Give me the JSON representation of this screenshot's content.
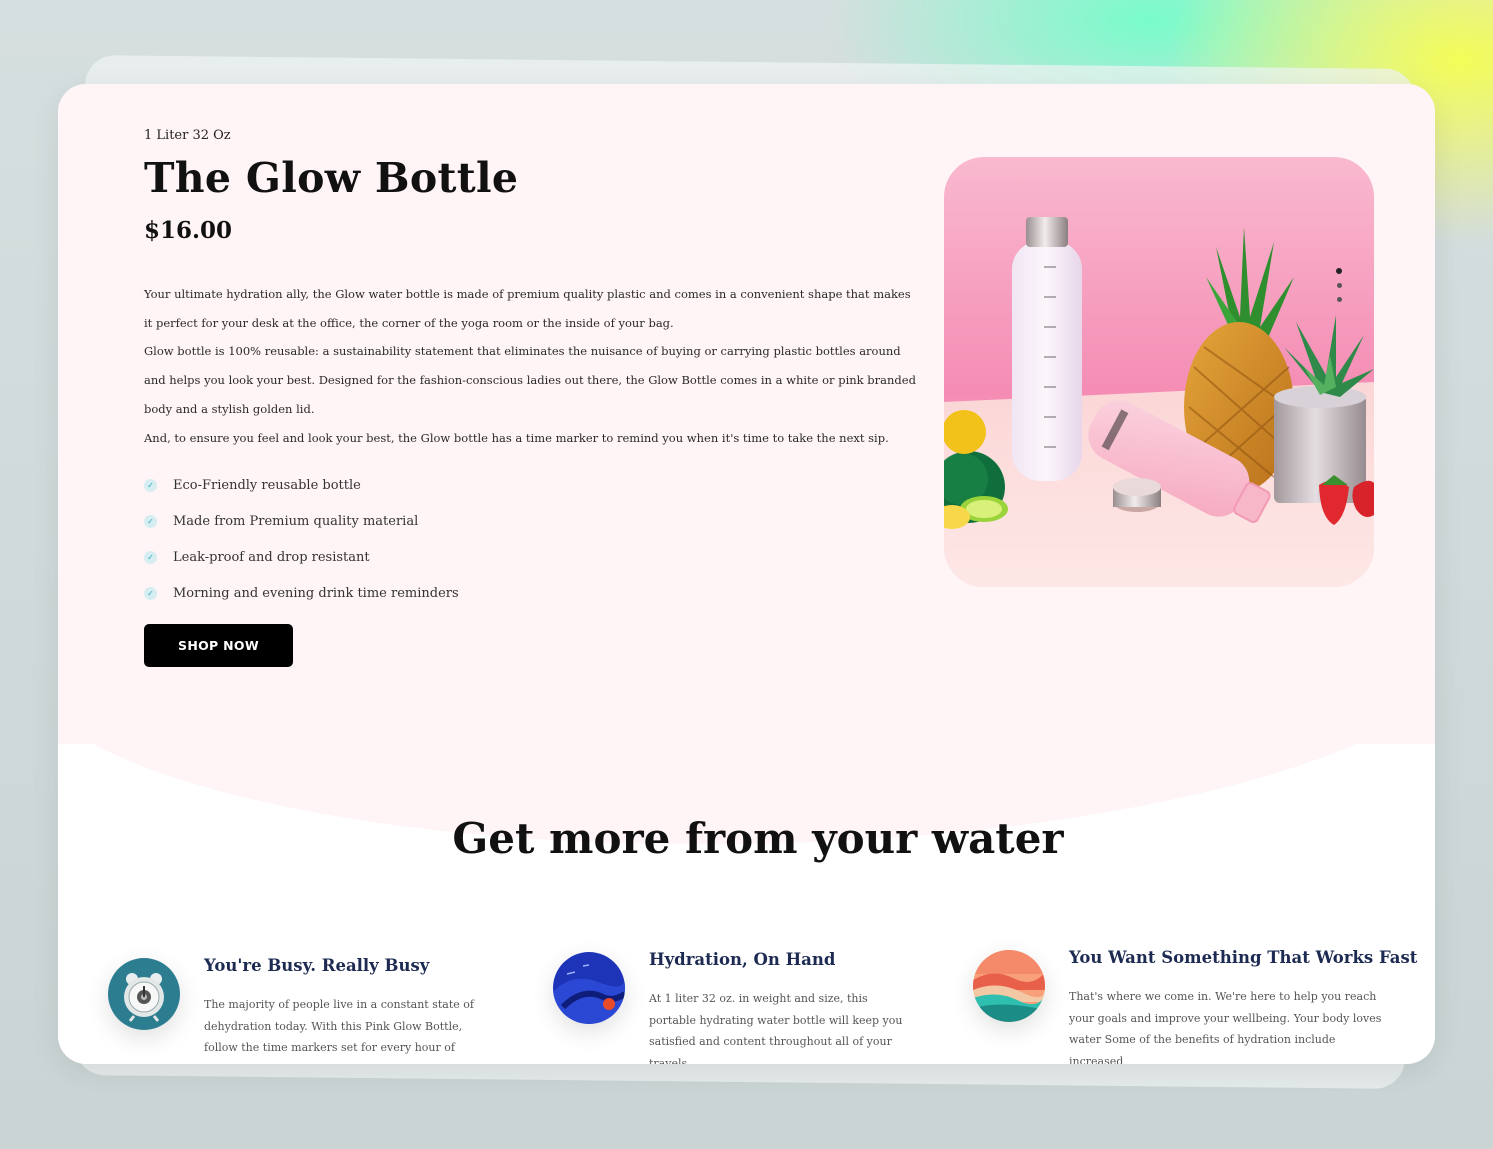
{
  "product": {
    "subtitle": "1 Liter 32 Oz",
    "title": "The Glow Bottle",
    "price": "$16.00",
    "description": [
      "Your ultimate hydration ally, the Glow water bottle is made of premium quality plastic and comes in a convenient shape that makes it perfect for your desk at the office, the corner of the yoga room or the inside of your bag.",
      "Glow bottle is 100% reusable: a sustainability statement that eliminates the nuisance of buying or carrying plastic bottles around and helps you look your best. Designed for the fashion-conscious ladies out there, the Glow Bottle comes in a white or pink branded body and a stylish golden lid.",
      "And, to ensure you feel and look your best, the Glow bottle has a time marker to remind you when it's time to take the next sip."
    ],
    "features": [
      "Eco-Friendly reusable bottle",
      "Made from Premium quality material",
      "Leak-proof and drop resistant",
      "Morning and evening drink time reminders"
    ],
    "cta_label": "SHOP NOW",
    "photo_icon": "product-photo-bottle-pineapple",
    "check_icon": "check-icon"
  },
  "section": {
    "title": "Get more from your water",
    "cards": [
      {
        "icon": "alarm-clock-icon",
        "heading": "You're Busy. Really Busy",
        "text": "The majority of people live in a constant state of dehydration today. With this Pink Glow Bottle, follow the time markers set for every hour of the"
      },
      {
        "icon": "ocean-planet-icon",
        "heading": "Hydration, On Hand",
        "text": "At 1 liter 32 oz. in weight and size, this portable hydrating water bottle will keep you satisfied and content throughout all of your travels."
      },
      {
        "icon": "sunset-landscape-icon",
        "heading": "You Want Something That Works Fast",
        "text": "That's where we come in. We're here to help you reach your goals and improve your wellbeing. Your body loves water Some of the benefits of hydration include increased"
      }
    ]
  },
  "colors": {
    "hero_background": "#fff4f6",
    "button": "#000000",
    "heading_navy": "#1d2a52",
    "check_teal": "#2aa6b8"
  }
}
